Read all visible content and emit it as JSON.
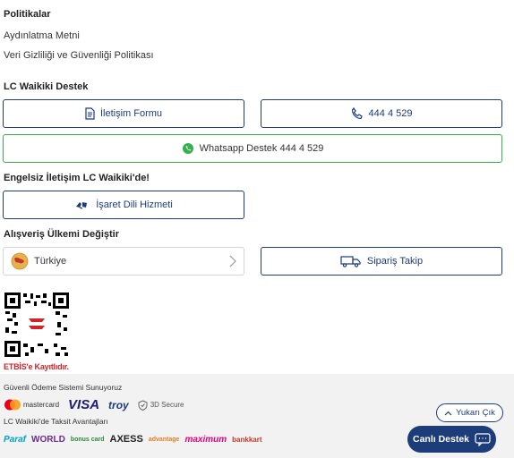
{
  "policies": {
    "title": "Politikalar",
    "links": [
      "Aydınlatma Metni",
      "Veri Gizliliği ve Güvenliği Politikası"
    ]
  },
  "support": {
    "title": "LC Waikiki Destek",
    "contact_form": "İletişim Formu",
    "phone": "444 4 529",
    "whatsapp": "Whatsapp Destek 444 4 529"
  },
  "accessibility": {
    "title": "Engelsiz İletişim LC Waikiki'de!",
    "sign_language": "İşaret Dili Hizmeti"
  },
  "country": {
    "title": "Alışveriş Ülkemi Değiştir",
    "selected": "Türkiye",
    "order_tracking": "Sipariş Takip"
  },
  "etbis": {
    "label": "ETBİS'e Kayıtlıdır."
  },
  "payment": {
    "title": "Güvenli Ödeme Sistemi Sunuyoruz",
    "logos": [
      "mastercard",
      "VISA",
      "troy",
      "3D Secure"
    ],
    "mastercard_text": "mastercard",
    "visa_text": "VISA",
    "troy_text": "troy",
    "secure_text": "3D Secure"
  },
  "installments": {
    "title": "LC Waikiki'de Taksit Avantajları",
    "banks": [
      "Paraf",
      "WORLD",
      "bonus card",
      "AXESS",
      "advantage",
      "maximum",
      "bankkart"
    ]
  },
  "floating": {
    "scroll_top": "Yukarı Çık",
    "live_support": "Canlı Destek"
  },
  "colors": {
    "primary": "#1c3c7a",
    "whatsapp": "#35b24a",
    "etbis_red": "#d3222a",
    "footer_bg": "#f2f2f2"
  }
}
